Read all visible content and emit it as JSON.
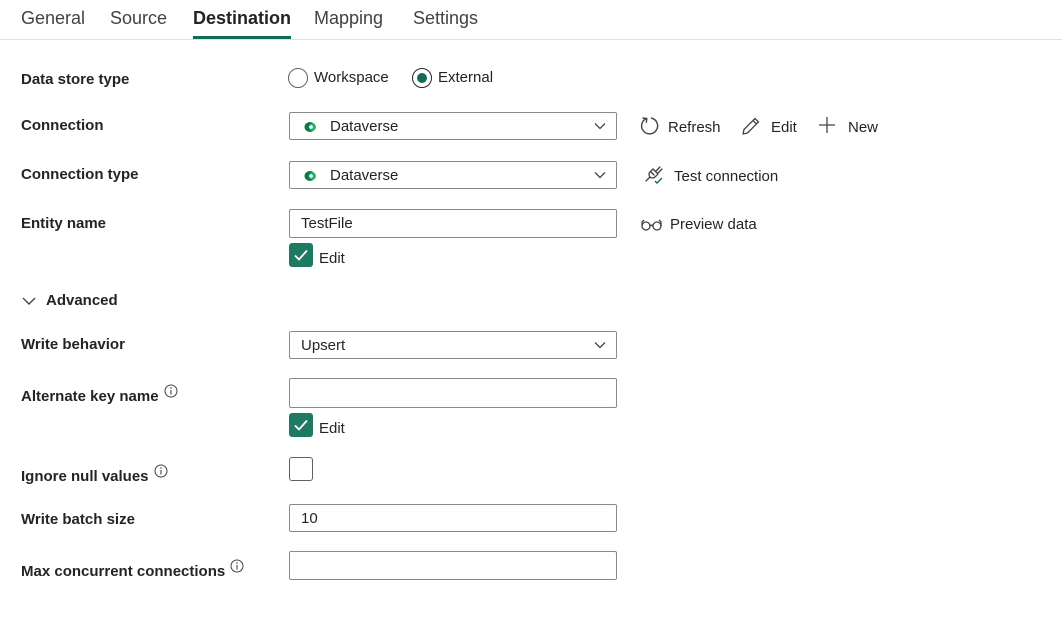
{
  "tabs": [
    {
      "label": "General"
    },
    {
      "label": "Source"
    },
    {
      "label": "Destination",
      "active": true
    },
    {
      "label": "Mapping"
    },
    {
      "label": "Settings"
    }
  ],
  "form": {
    "data_store_type": {
      "label": "Data store type",
      "options": [
        "Workspace",
        "External"
      ],
      "selected": "External"
    },
    "connection": {
      "label": "Connection",
      "value": "Dataverse",
      "actions": {
        "refresh": "Refresh",
        "edit": "Edit",
        "new": "New"
      }
    },
    "connection_type": {
      "label": "Connection type",
      "value": "Dataverse",
      "action": "Test connection"
    },
    "entity_name": {
      "label": "Entity name",
      "value": "TestFile",
      "action": "Preview data",
      "edit_checkbox": {
        "label": "Edit",
        "checked": true
      }
    },
    "advanced": {
      "label": "Advanced",
      "expanded": true
    },
    "write_behavior": {
      "label": "Write behavior",
      "value": "Upsert"
    },
    "alternate_key_name": {
      "label": "Alternate key name",
      "value": "",
      "edit_checkbox": {
        "label": "Edit",
        "checked": true
      }
    },
    "ignore_null_values": {
      "label": "Ignore null values",
      "checked": false
    },
    "write_batch_size": {
      "label": "Write batch size",
      "value": "10"
    },
    "max_concurrent_connections": {
      "label": "Max concurrent connections",
      "value": ""
    }
  },
  "colors": {
    "accent": "#0f6e5a",
    "checkbox": "#1f7a63"
  }
}
